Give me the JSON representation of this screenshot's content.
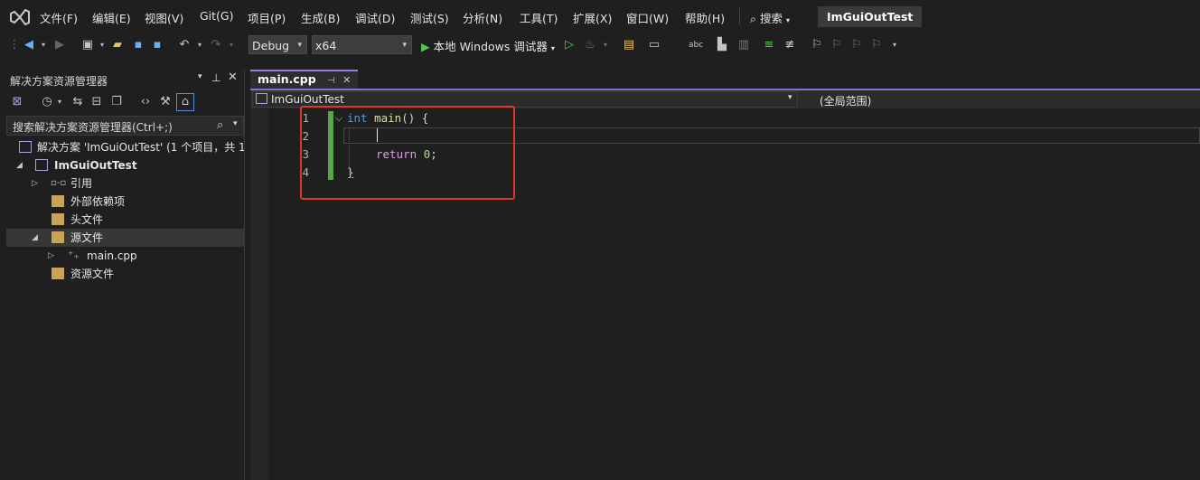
{
  "menu": {
    "items": [
      "文件(F)",
      "编辑(E)",
      "视图(V)",
      "Git(G)",
      "项目(P)",
      "生成(B)",
      "调试(D)",
      "测试(S)",
      "分析(N)",
      "工具(T)",
      "扩展(X)",
      "窗口(W)",
      "帮助(H)"
    ],
    "search_label": "搜索",
    "project_title": "ImGuiOutTest"
  },
  "toolbar": {
    "config": "Debug",
    "platform": "x64",
    "run_label": "本地 Windows 调试器"
  },
  "solution_explorer": {
    "title": "解决方案资源管理器",
    "search_placeholder": "搜索解决方案资源管理器(Ctrl+;)",
    "tree": [
      {
        "label": "解决方案 'ImGuiOutTest' (1 个项目，共 1",
        "bold": false
      },
      {
        "label": "ImGuiOutTest",
        "bold": true
      },
      {
        "label": "引用",
        "bold": false
      },
      {
        "label": "外部依赖项",
        "bold": false
      },
      {
        "label": "头文件",
        "bold": false
      },
      {
        "label": "源文件",
        "bold": false
      },
      {
        "label": "main.cpp",
        "bold": false
      },
      {
        "label": "资源文件",
        "bold": false
      }
    ]
  },
  "editor": {
    "tab_label": "main.cpp",
    "nav_project": "ImGuiOutTest",
    "nav_scope": "(全局范围)",
    "line_numbers": [
      "1",
      "2",
      "3",
      "4"
    ],
    "code": {
      "line1": {
        "kw": "int",
        "fn": "main",
        "rest": "() {"
      },
      "line3": {
        "kw": "return",
        "num": "0",
        "rest": ";"
      },
      "line4": "}"
    }
  },
  "colors": {
    "accent": "#8a6dd6",
    "highlight_box": "#e0352b",
    "change_bar": "#57a64a"
  }
}
